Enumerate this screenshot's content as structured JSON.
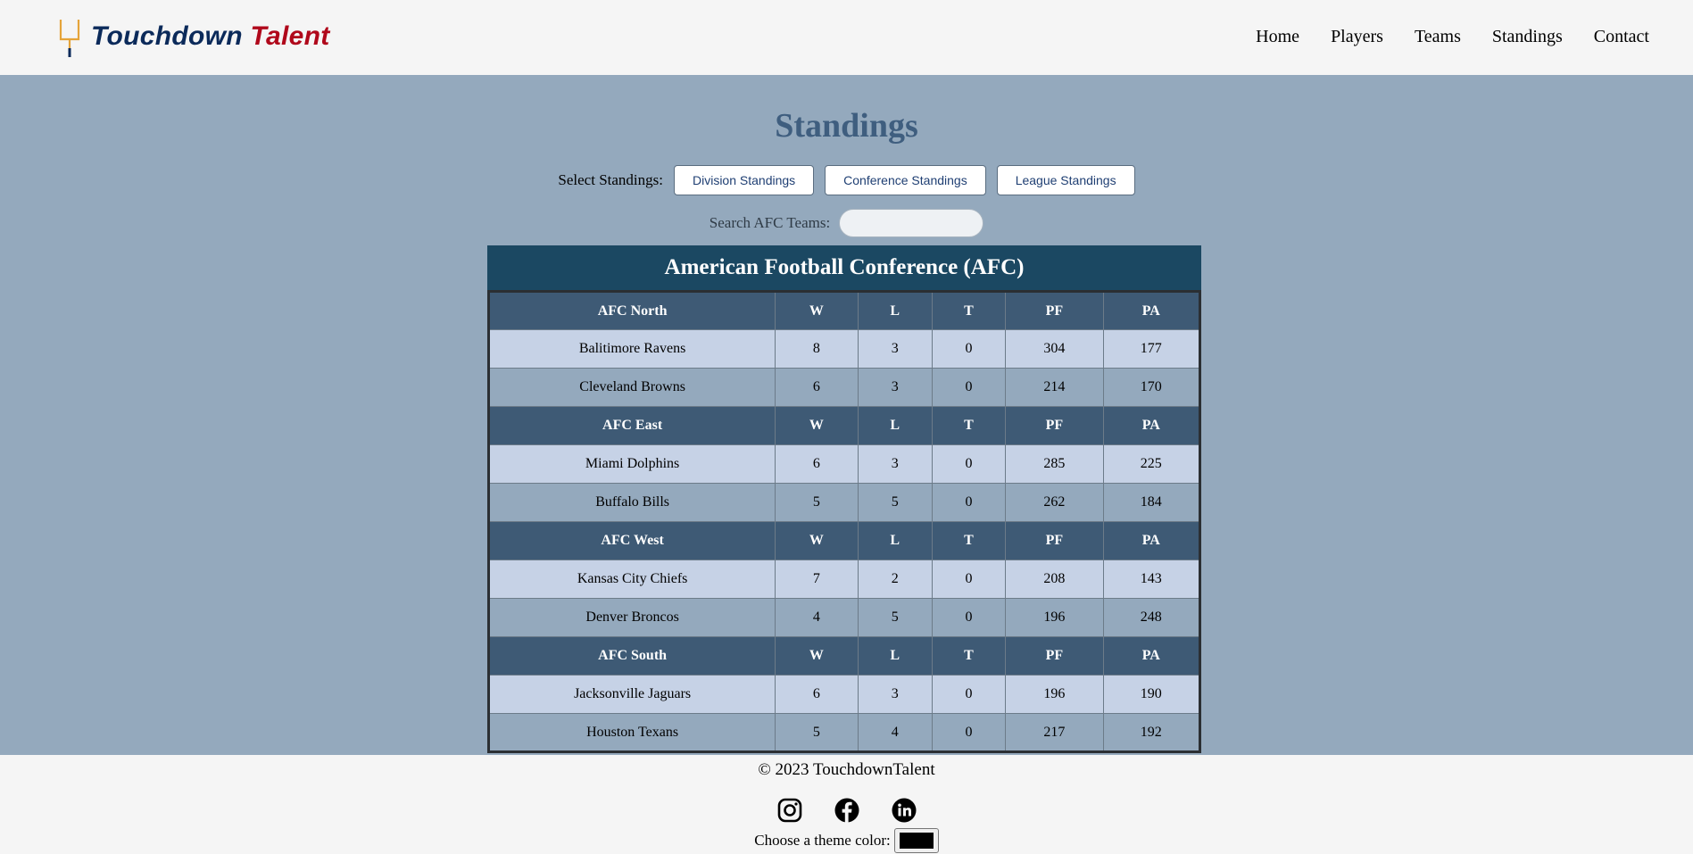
{
  "brand": {
    "word1": "Touchdown",
    "word2": "Talent",
    "colors": {
      "navy": "#0b2a5a",
      "red": "#b0081b",
      "post": "#e5a43a"
    }
  },
  "nav": [
    "Home",
    "Players",
    "Teams",
    "Standings",
    "Contact"
  ],
  "page": {
    "title": "Standings",
    "select_label": "Select Standings:",
    "buttons": [
      "Division Standings",
      "Conference Standings",
      "League Standings"
    ],
    "search_label": "Search AFC Teams:",
    "search_value": ""
  },
  "conference": {
    "title": "American Football Conference (AFC)",
    "columns": [
      "W",
      "L",
      "T",
      "PF",
      "PA"
    ],
    "divisions": [
      {
        "name": "AFC North",
        "teams": [
          {
            "team": "Balitimore Ravens",
            "w": "8",
            "l": "3",
            "t": "0",
            "pf": "304",
            "pa": "177"
          },
          {
            "team": "Cleveland Browns",
            "w": "6",
            "l": "3",
            "t": "0",
            "pf": "214",
            "pa": "170"
          }
        ]
      },
      {
        "name": "AFC East",
        "teams": [
          {
            "team": "Miami Dolphins",
            "w": "6",
            "l": "3",
            "t": "0",
            "pf": "285",
            "pa": "225"
          },
          {
            "team": "Buffalo Bills",
            "w": "5",
            "l": "5",
            "t": "0",
            "pf": "262",
            "pa": "184"
          }
        ]
      },
      {
        "name": "AFC West",
        "teams": [
          {
            "team": "Kansas City Chiefs",
            "w": "7",
            "l": "2",
            "t": "0",
            "pf": "208",
            "pa": "143"
          },
          {
            "team": "Denver Broncos",
            "w": "4",
            "l": "5",
            "t": "0",
            "pf": "196",
            "pa": "248"
          }
        ]
      },
      {
        "name": "AFC South",
        "teams": [
          {
            "team": "Jacksonville Jaguars",
            "w": "6",
            "l": "3",
            "t": "0",
            "pf": "196",
            "pa": "190"
          },
          {
            "team": "Houston Texans",
            "w": "5",
            "l": "4",
            "t": "0",
            "pf": "217",
            "pa": "192"
          }
        ]
      }
    ]
  },
  "footer": {
    "copyright": "© 2023 TouchdownTalent",
    "social_icons": [
      "instagram-icon",
      "facebook-icon",
      "linkedin-icon"
    ],
    "theme_label": "Choose a theme color:",
    "theme_color": "#000000"
  }
}
